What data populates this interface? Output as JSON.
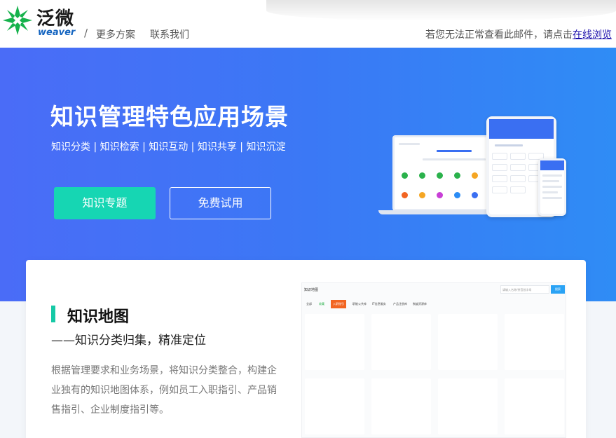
{
  "header": {
    "logo_cn": "泛微",
    "logo_en": "weaver",
    "separator": "/",
    "nav": {
      "more": "更多方案",
      "contact": "联系我们"
    },
    "notice_text": "若您无法正常查看此邮件，请点击",
    "notice_link": "在线浏览"
  },
  "hero": {
    "title": "知识管理特色应用场景",
    "subtitle": "知识分类 | 知识检索 | 知识互动 | 知识共享 | 知识沉淀",
    "primary_button": "知识专题",
    "secondary_button": "免费试用",
    "colors": {
      "gradient_start": "#4a6cf7",
      "gradient_end": "#2f8cf5",
      "accent": "#16d6b3"
    }
  },
  "feature": {
    "title": "知识地图",
    "subtitle": "——知识分类归集，精准定位",
    "description": "根据管理要求和业务场景，将知识分类整合，构建企业独有的知识地图体系，例如员工入职指引、产品销售指引、企业制度指引等。",
    "accent_color": "#16c9a6"
  },
  "mock_screenshot": {
    "title": "知识地图",
    "search_placeholder": "请输入名称/拼音首字母",
    "search_button": "搜索",
    "tabs": [
      "全部",
      "收藏",
      "入职指引",
      "职能公共库",
      "IT信息服务",
      "产品注册库",
      "制度资源库"
    ]
  }
}
